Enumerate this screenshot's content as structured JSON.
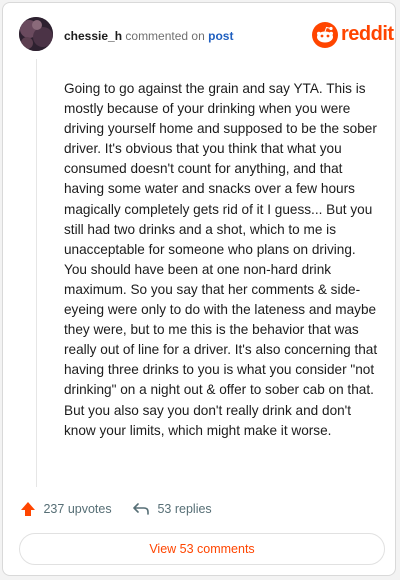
{
  "header": {
    "username": "chessie_h",
    "action": "commented on",
    "link": "post",
    "brand": "reddit",
    "avatar": "avatar-image"
  },
  "comment": {
    "body": "Going to go against the grain and say YTA. This is mostly because of your drinking when you were driving yourself home and supposed to be the sober driver. It's obvious that you think that what you consumed doesn't count for anything, and that having some water and snacks over a few hours magically completely gets rid of it I guess... But you still had two drinks and a shot, which to me is unacceptable for someone who plans on driving. You should have been at one non-hard drink maximum. So you say that her comments & side-eyeing were only to do with the lateness and maybe they were, but to me this is the behavior that was really out of line for a driver. It's also concerning that having three drinks to you is what you consider \"not drinking\" on a night out & offer to sober cab on that. But you also say you don't really drink and don't know your limits, which might make it worse."
  },
  "footer": {
    "upvotes": "237 upvotes",
    "replies": "53 replies",
    "upvote_icon": "upvote-arrow-icon",
    "reply_icon": "reply-arrow-icon"
  },
  "view_comments": "View 53 comments",
  "colors": {
    "brand": "#ff4500",
    "link": "#1f5fbf",
    "text": "#1c1c1c",
    "muted": "#576f76"
  }
}
